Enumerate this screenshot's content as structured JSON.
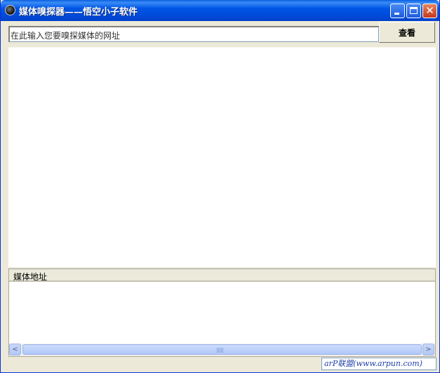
{
  "window": {
    "title": "媒体嗅探器——悟空小子软件"
  },
  "toolbar": {
    "url_value": "在此输入您要嗅探媒体的网址",
    "view_button": "查看"
  },
  "media_list": {
    "columns": [
      "媒体地址"
    ],
    "rows": []
  },
  "scrollbar": {
    "left_arrow": "<",
    "right_arrow": ">"
  },
  "status": {
    "link_text": "arP联盟(www.arpun.com)"
  },
  "icons": {
    "app": "app-icon",
    "minimize": "minimize-icon",
    "maximize": "maximize-icon",
    "close": "close-icon"
  },
  "colors": {
    "titlebar": "#0055E5",
    "background": "#ECE9D8",
    "close": "#C4391A"
  }
}
